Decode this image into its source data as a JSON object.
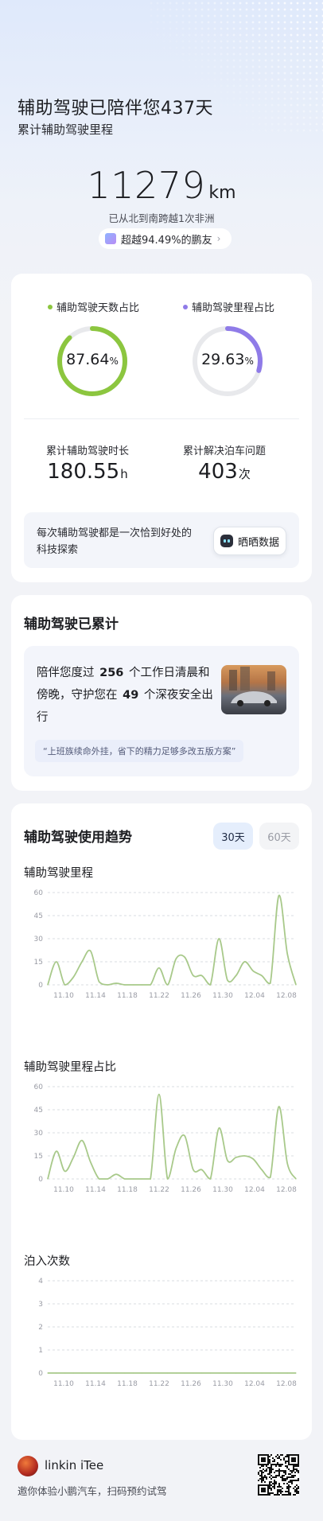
{
  "hero": {
    "title": "辅助驾驶已陪伴您437天",
    "subtitle": "累计辅助驾驶里程",
    "distance_value": "11279",
    "distance_unit": "km",
    "note": "已从北到南跨越1次非洲",
    "rank_text": "超越94.49%的鹏友"
  },
  "stats": {
    "days_ratio_label": "辅助驾驶天数占比",
    "days_ratio_value": "87.64",
    "days_ratio_fraction": 0.8764,
    "mileage_ratio_label": "辅助驾驶里程占比",
    "mileage_ratio_value": "29.63",
    "mileage_ratio_fraction": 0.2963,
    "percent_unit": "%",
    "duration_label": "累计辅助驾驶时长",
    "duration_value": "180.55",
    "duration_unit": "h",
    "parking_label": "累计解决泊车问题",
    "parking_value": "403",
    "parking_unit": "次",
    "share_text": "每次辅助驾驶都是一次恰到好处的科技探索",
    "share_button": "晒晒数据",
    "colors": {
      "days": "#8cc63f",
      "mileage": "#8f7be8",
      "track": "#e8e9ec"
    }
  },
  "accumulated": {
    "title": "辅助驾驶已累计",
    "line_prefix": "陪伴您度过",
    "workdays": "256",
    "line_middle": "个工作日清晨和傍晚，守护您在",
    "nights": "49",
    "line_suffix": "个深夜安全出行",
    "quote": "“上班族续命外挂，省下的精力足够多改五版方案”"
  },
  "trend": {
    "title": "辅助驾驶使用趋势",
    "tab_30": "30天",
    "tab_60": "60天",
    "line_color": "#a8c98a"
  },
  "chart_data": [
    {
      "type": "line",
      "title": "辅助驾驶里程",
      "x_ticks": [
        "11.10",
        "11.14",
        "11.18",
        "11.22",
        "11.26",
        "11.30",
        "12.04",
        "12.08"
      ],
      "y_ticks": [
        "0",
        "15",
        "30",
        "45",
        "60"
      ],
      "ylim": [
        0,
        60
      ],
      "x": [
        0,
        1,
        2,
        3,
        4,
        5,
        6,
        7,
        8,
        9,
        10,
        11,
        12,
        13,
        14,
        15,
        16,
        17,
        18,
        19,
        20,
        21,
        22,
        23,
        24,
        25,
        26,
        27,
        28,
        29
      ],
      "values": [
        0,
        15,
        0,
        5,
        15,
        22,
        2,
        0,
        1,
        0,
        0,
        0,
        0,
        11,
        0,
        17,
        18,
        6,
        6,
        0,
        30,
        3,
        6,
        15,
        9,
        6,
        1,
        58,
        20,
        0
      ]
    },
    {
      "type": "line",
      "title": "辅助驾驶里程占比",
      "x_ticks": [
        "11.10",
        "11.14",
        "11.18",
        "11.22",
        "11.26",
        "11.30",
        "12.04",
        "12.08"
      ],
      "y_ticks": [
        "0",
        "15",
        "30",
        "45",
        "60"
      ],
      "ylim": [
        0,
        60
      ],
      "x": [
        0,
        1,
        2,
        3,
        4,
        5,
        6,
        7,
        8,
        9,
        10,
        11,
        12,
        13,
        14,
        15,
        16,
        17,
        18,
        19,
        20,
        21,
        22,
        23,
        24,
        25,
        26,
        27,
        28,
        29
      ],
      "values": [
        0,
        18,
        5,
        14,
        25,
        11,
        0,
        0,
        3,
        0,
        0,
        0,
        0,
        55,
        0,
        20,
        28,
        6,
        6,
        0,
        33,
        12,
        14,
        15,
        13,
        6,
        1,
        47,
        10,
        0
      ]
    },
    {
      "type": "line",
      "title": "泊入次数",
      "x_ticks": [
        "11.10",
        "11.14",
        "11.18",
        "11.22",
        "11.26",
        "11.30",
        "12.04",
        "12.08"
      ],
      "y_ticks": [
        "0",
        "1",
        "2",
        "3",
        "4"
      ],
      "ylim": [
        0,
        4
      ],
      "x": [
        0,
        1,
        2,
        3,
        4,
        5,
        6,
        7,
        8,
        9,
        10,
        11,
        12,
        13,
        14,
        15,
        16,
        17,
        18,
        19,
        20,
        21,
        22,
        23,
        24,
        25,
        26,
        27,
        28,
        29
      ],
      "values": [
        0,
        0,
        0,
        0,
        0,
        0,
        0,
        0,
        0,
        0,
        0,
        0,
        0,
        0,
        0,
        0,
        0,
        0,
        0,
        0,
        0,
        0,
        0,
        0,
        0,
        0,
        0,
        0,
        0,
        0
      ]
    }
  ],
  "footer": {
    "name": "linkin iTee",
    "invite": "邀你体验小鹏汽车，扫码预约试驾"
  }
}
